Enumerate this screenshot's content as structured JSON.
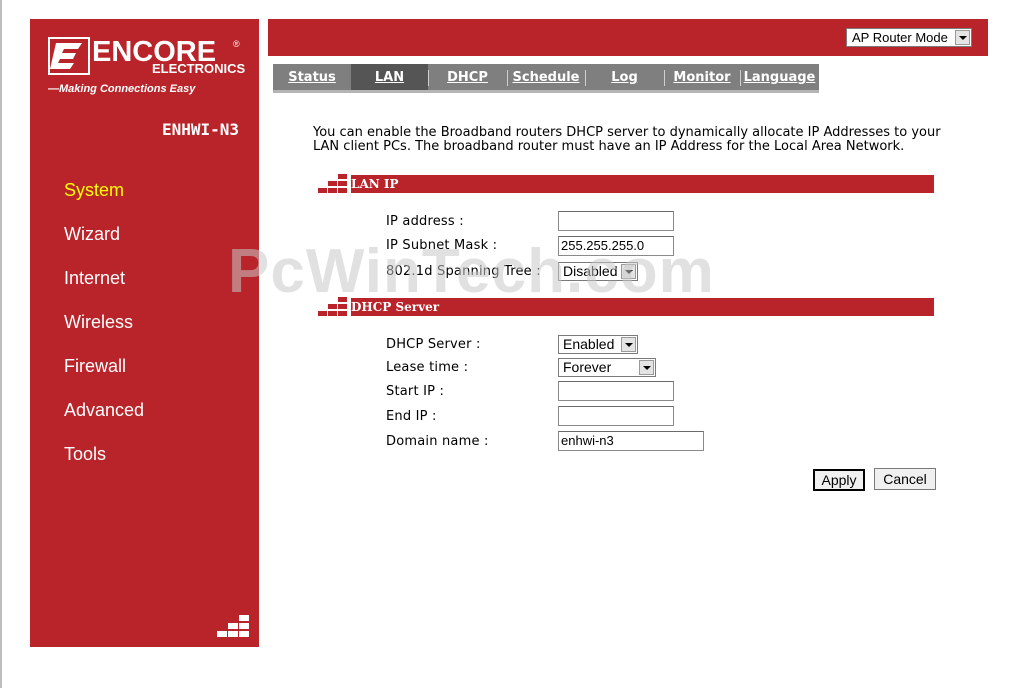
{
  "brand": {
    "name": "ENCORE",
    "sub": "ELECTRONICS",
    "registered": "®",
    "tagline": "—Making Connections Easy",
    "model": "ENHWI-N3"
  },
  "sidebar": {
    "items": [
      {
        "label": "System",
        "active": true
      },
      {
        "label": "Wizard"
      },
      {
        "label": "Internet"
      },
      {
        "label": "Wireless"
      },
      {
        "label": "Firewall"
      },
      {
        "label": "Advanced"
      },
      {
        "label": "Tools"
      }
    ]
  },
  "header": {
    "mode_select": "AP Router Mode"
  },
  "tabs": [
    {
      "label": "Status"
    },
    {
      "label": "LAN",
      "active": true
    },
    {
      "label": "DHCP"
    },
    {
      "label": "Schedule"
    },
    {
      "label": "Log"
    },
    {
      "label": "Monitor"
    },
    {
      "label": "Language"
    }
  ],
  "intro": "You can enable the Broadband routers DHCP server to dynamically allocate IP Addresses to your LAN client PCs. The broadband router must have an IP Address for the Local Area Network.",
  "lan_ip": {
    "title": "LAN IP",
    "ip_address_label": "IP address :",
    "ip_address_value": "",
    "subnet_label": "IP Subnet Mask :",
    "subnet_value": "255.255.255.0",
    "stp_label": "802.1d Spanning Tree :",
    "stp_value": "Disabled"
  },
  "dhcp": {
    "title": "DHCP Server",
    "server_label": "DHCP Server :",
    "server_value": "Enabled",
    "lease_label": "Lease time :",
    "lease_value": "Forever",
    "start_label": "Start IP :",
    "start_value": "",
    "end_label": "End IP :",
    "end_value": "",
    "domain_label": "Domain name :",
    "domain_value": "enhwi-n3"
  },
  "actions": {
    "apply": "Apply",
    "cancel": "Cancel"
  },
  "watermark": "PcWinTech.com",
  "colors": {
    "brand_red": "#b8242a",
    "active_menu": "#ffff00",
    "tab_gray": "#7f7f7f"
  }
}
